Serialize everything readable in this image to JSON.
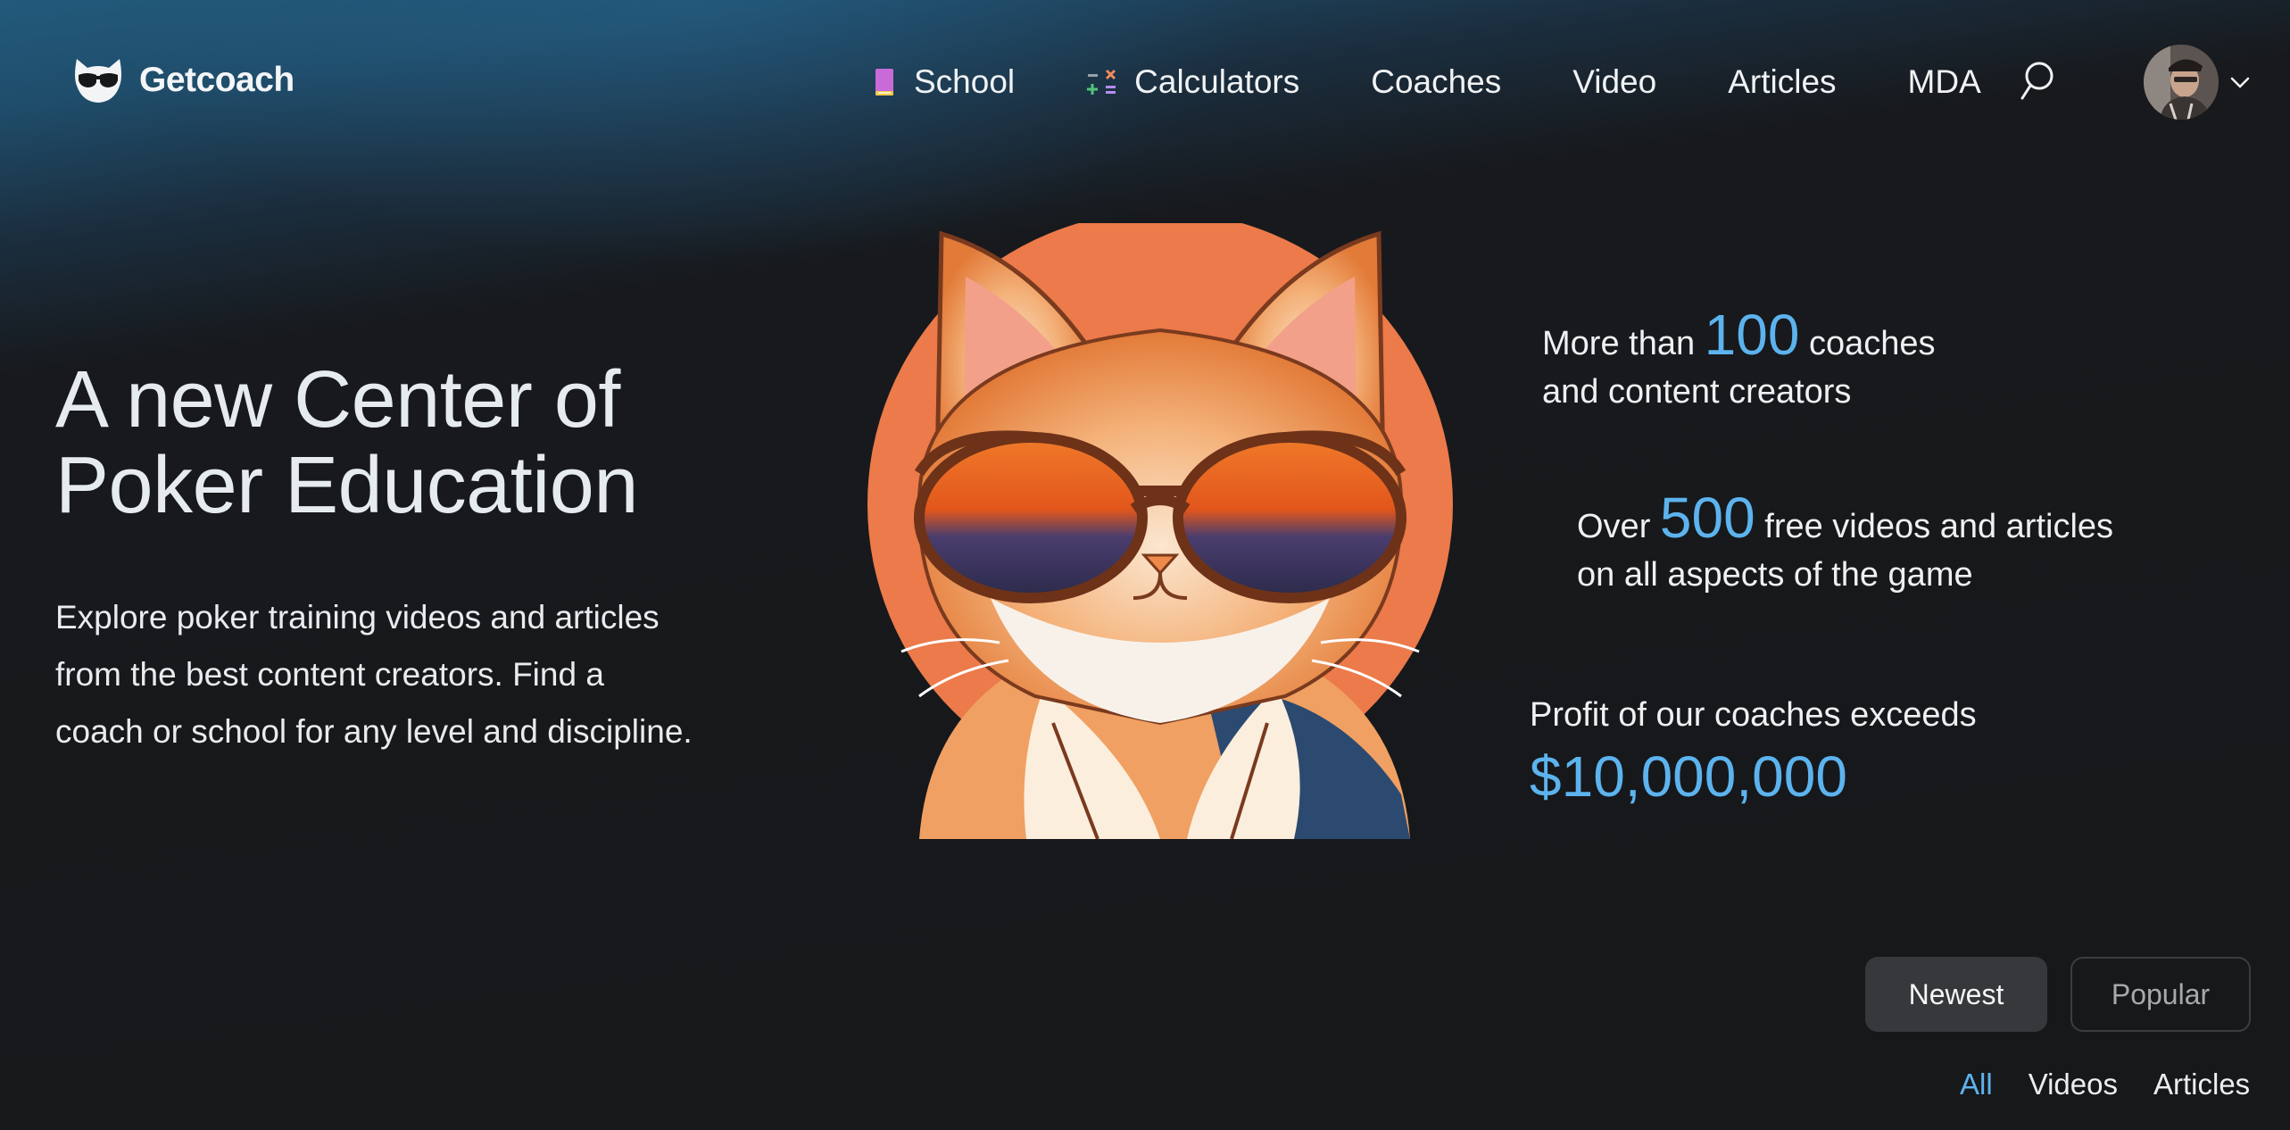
{
  "brand": {
    "name": "Getcoach",
    "logo_icon": "cat-sunglasses-icon"
  },
  "nav": {
    "items": [
      {
        "label": "School",
        "icon": "book-icon"
      },
      {
        "label": "Calculators",
        "icon": "calculator-icon"
      },
      {
        "label": "Coaches"
      },
      {
        "label": "Video"
      },
      {
        "label": "Articles"
      },
      {
        "label": "MDA"
      }
    ],
    "search_icon": "search-icon",
    "profile_icon": "avatar",
    "dropdown_icon": "chevron-down-icon"
  },
  "hero": {
    "title_line1": "A new Center of",
    "title_line2": "Poker Education",
    "subtitle_line1": "Explore poker training videos and articles",
    "subtitle_line2": "from the best content creators. Find a",
    "subtitle_line3": "coach or school for any level and discipline.",
    "illustration": "cat-with-sunglasses"
  },
  "stats": {
    "coaches_prefix": "More than",
    "coaches_value": "100",
    "coaches_suffix": "coaches",
    "coaches_line2": "and content creators",
    "videos_prefix": "Over",
    "videos_value": "500",
    "videos_suffix": "free videos and articles",
    "videos_line2": "on all aspects of the game",
    "profit_label": "Profit of our coaches exceeds",
    "profit_value": "$10,000,000"
  },
  "sort_tabs": {
    "newest": "Newest",
    "popular": "Popular",
    "active": "Newest"
  },
  "filters": {
    "all": "All",
    "videos": "Videos",
    "articles": "Articles",
    "active": "All"
  },
  "colors": {
    "accent": "#5cb3ee",
    "background": "#17181a",
    "header_gradient": "#235a7c",
    "cat_circle": "#ec7a4a"
  }
}
